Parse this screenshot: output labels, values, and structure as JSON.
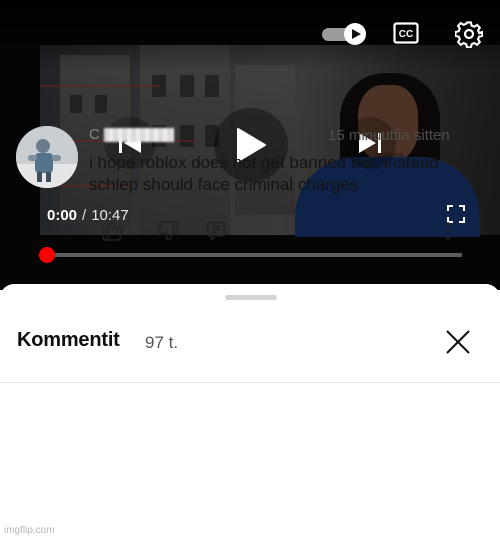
{
  "player": {
    "time_current": "0:00",
    "time_separator": "/",
    "time_duration": "10:47",
    "progress_fraction": 0.0,
    "accent_color": "#ff0000",
    "icons": [
      "autoplay-toggle-icon",
      "captions-icon",
      "settings-gear-icon",
      "previous-icon",
      "play-icon",
      "next-icon",
      "fullscreen-icon"
    ]
  },
  "comments": {
    "title": "Kommentit",
    "count": "97 t.",
    "items": [
      {
        "author": "C",
        "time": "15 minuuttia sitten",
        "text": "i hope roblox does not get banned but, instead schlep should face criminal charges"
      }
    ]
  },
  "watermark": "imgflip.com"
}
